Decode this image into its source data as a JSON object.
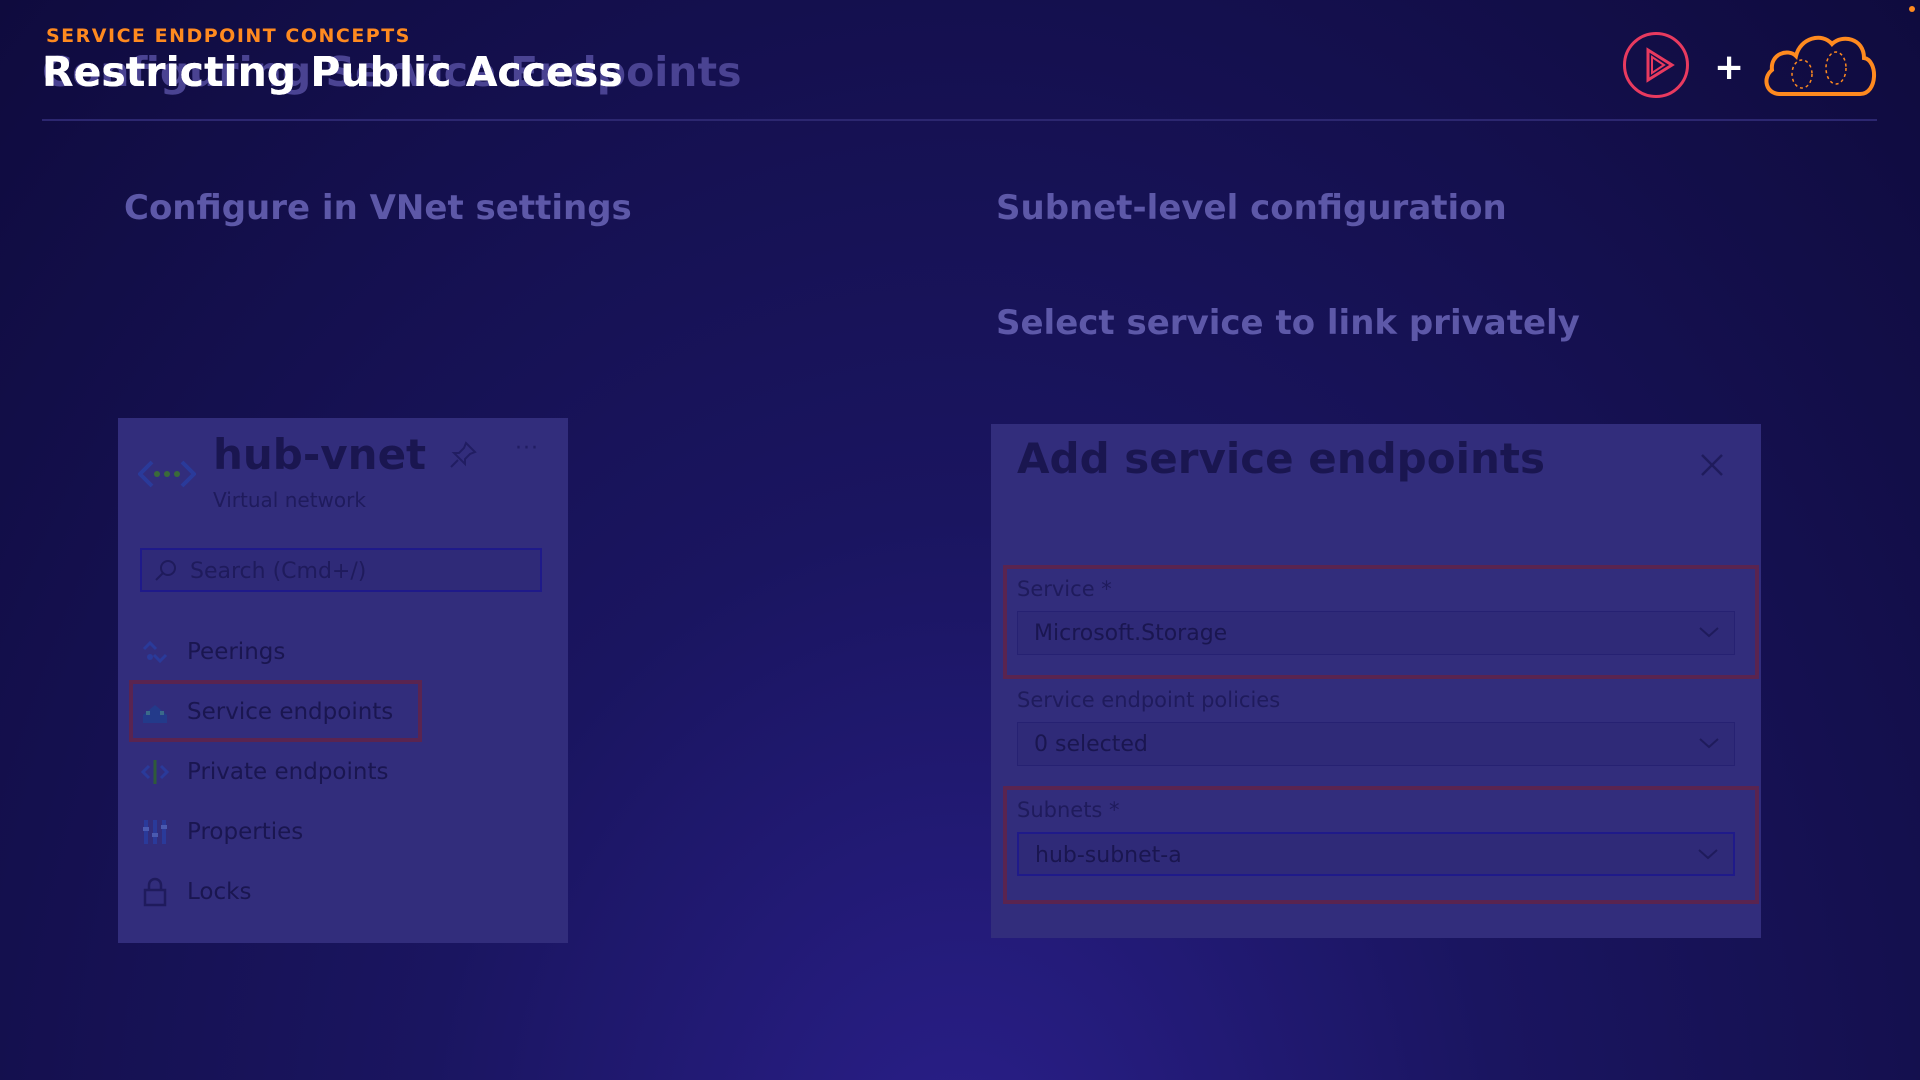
{
  "header": {
    "kicker": "SERVICE ENDPOINT CONCEPTS",
    "title": "Restricting Public Access",
    "title_ghost": "Configuring Service Endpoints"
  },
  "sections": {
    "left_heading": "Configure in VNet settings",
    "right_heading": "Subnet-level configuration",
    "right_subheading": "Select service to link privately"
  },
  "vnet_panel": {
    "title": "hub-vnet",
    "subtitle": "Virtual network",
    "more": "···",
    "search_placeholder": "Search (Cmd+/)",
    "items": [
      {
        "label": "Peerings",
        "icon": "peerings-icon"
      },
      {
        "label": "Service endpoints",
        "icon": "service-endpoints-icon",
        "highlighted": true
      },
      {
        "label": "Private endpoints",
        "icon": "private-endpoints-icon"
      },
      {
        "label": "Properties",
        "icon": "properties-icon"
      },
      {
        "label": "Locks",
        "icon": "lock-icon"
      }
    ]
  },
  "dialog": {
    "title": "Add service endpoints",
    "service_label": "Service *",
    "service_value": "Microsoft.Storage",
    "policies_label": "Service endpoint policies",
    "policies_value": "0 selected",
    "subnets_label": "Subnets *",
    "subnets_value": "hub-subnet-a"
  },
  "colors": {
    "accent_orange": "#ff8a1f",
    "highlight_border": "#5a2450",
    "logo_red": "#e83a5f"
  }
}
